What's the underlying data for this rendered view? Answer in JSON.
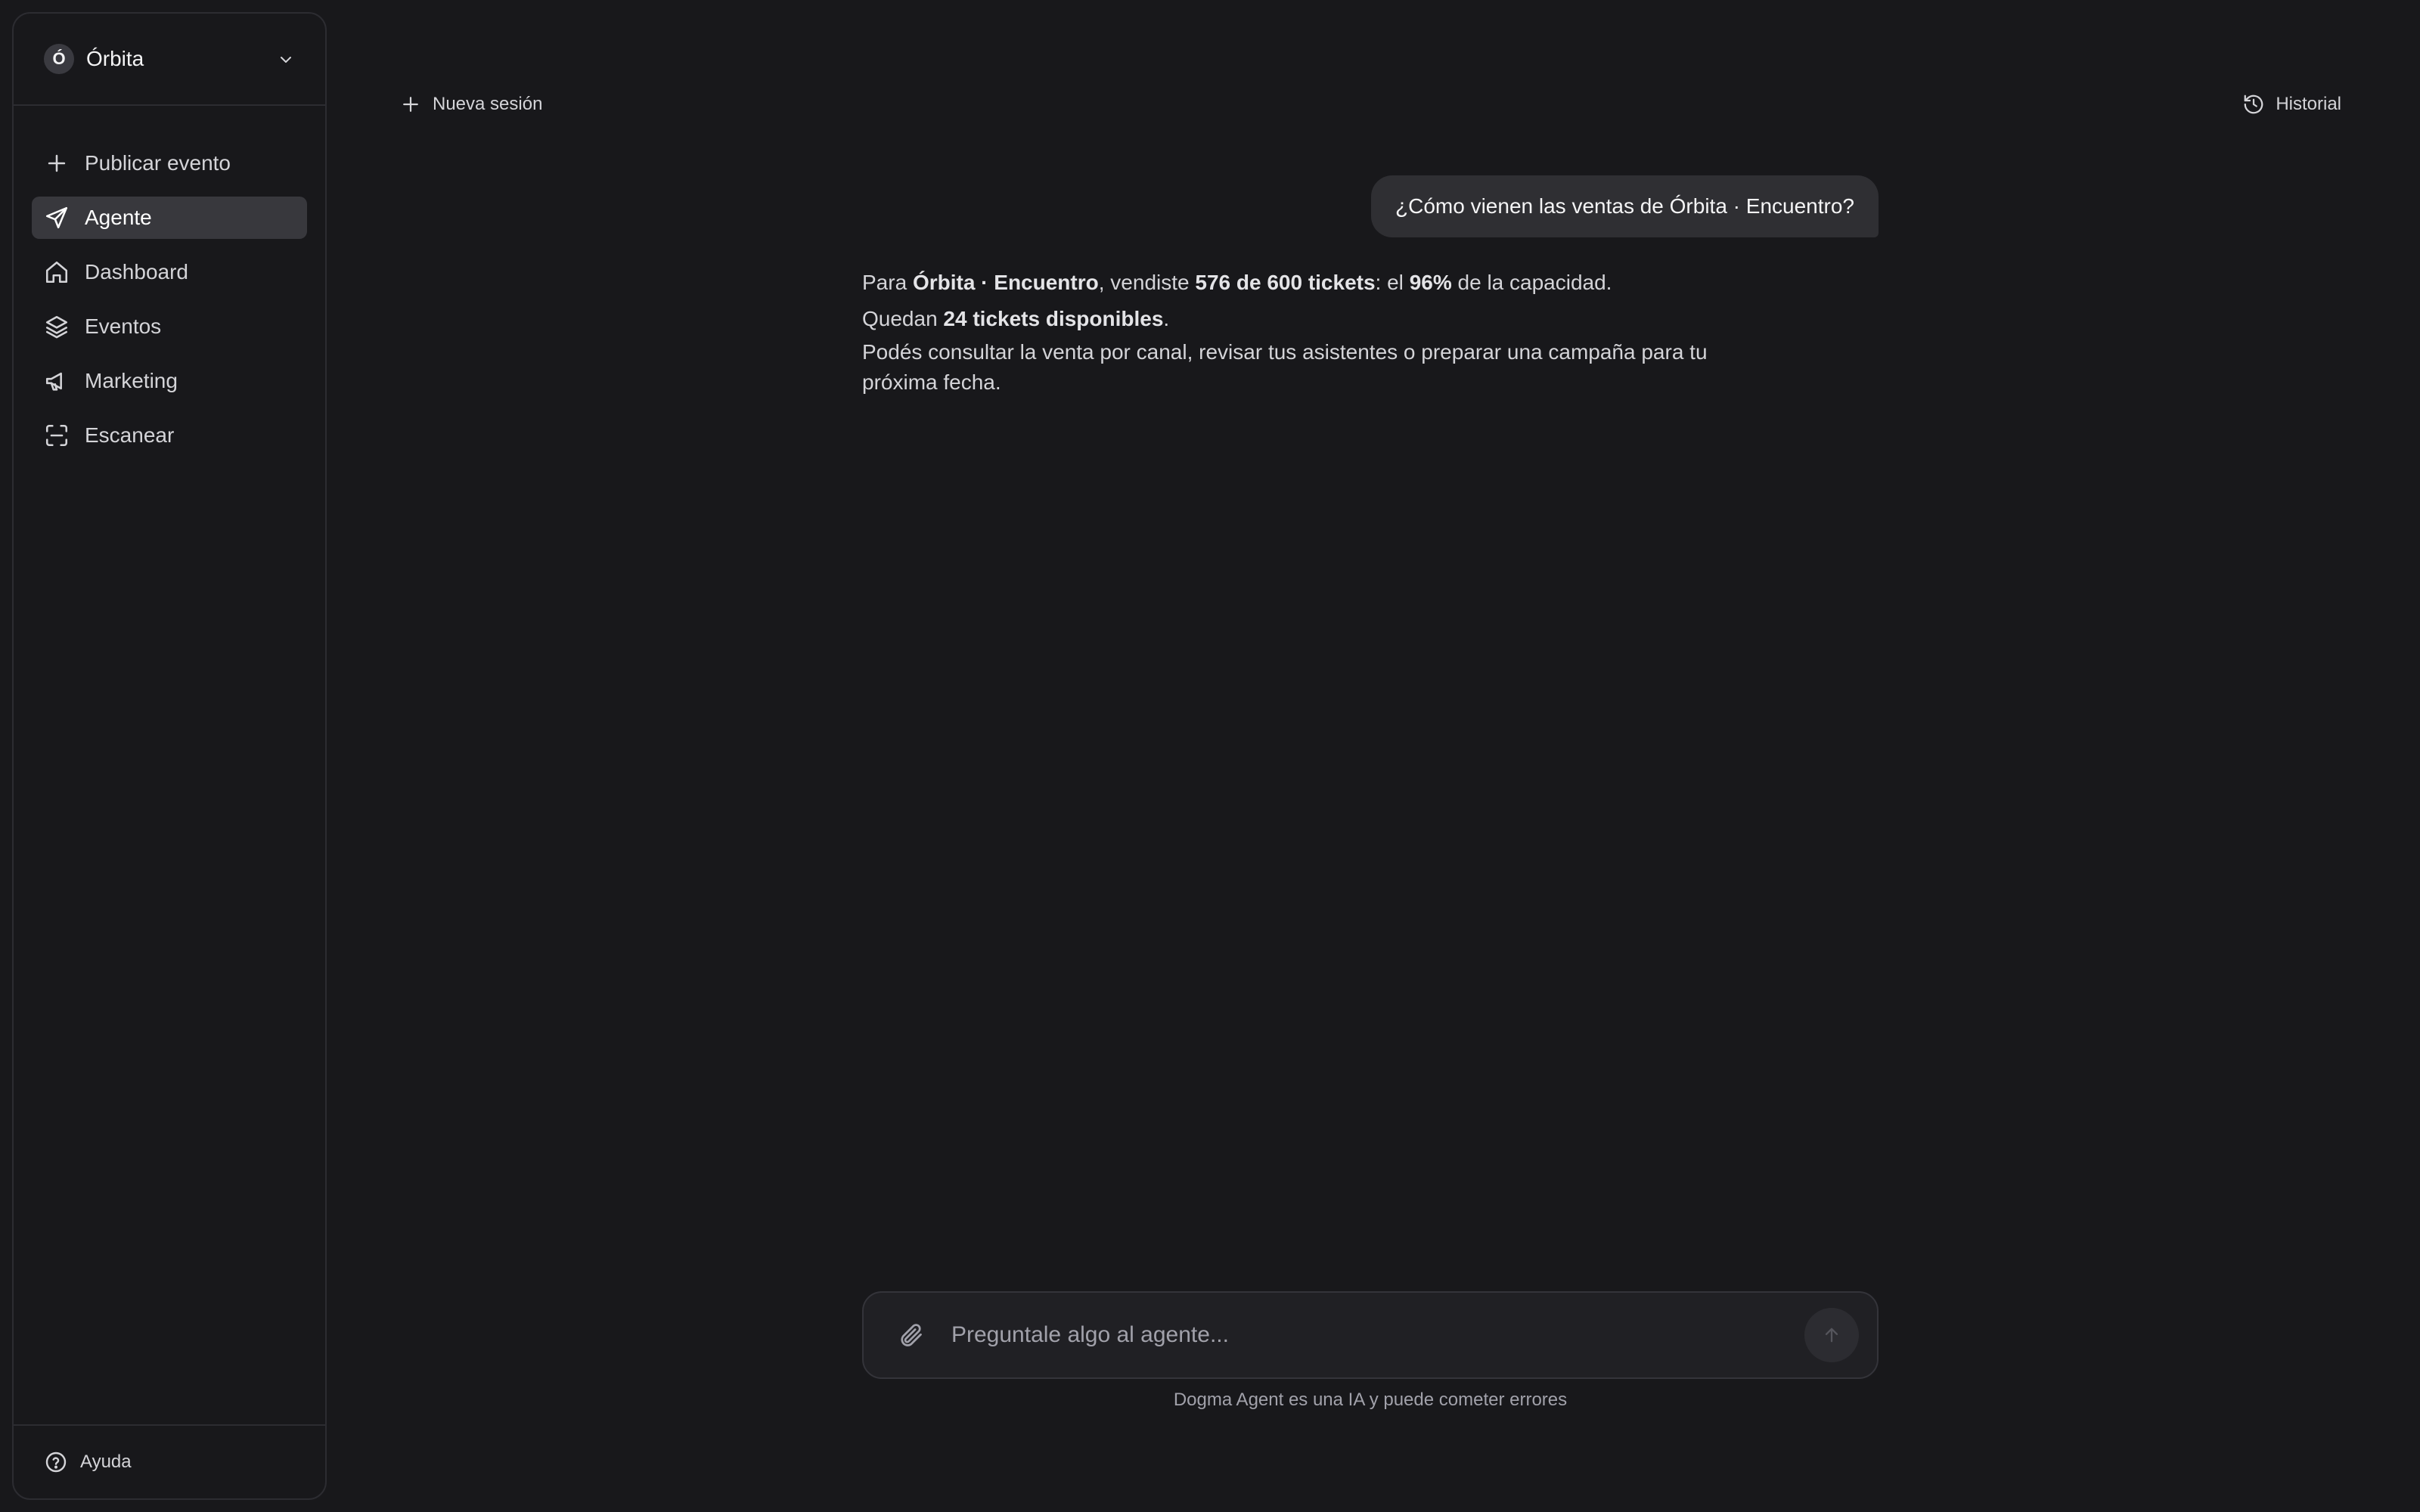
{
  "workspace": {
    "initial": "Ó",
    "name": "Órbita"
  },
  "nav": [
    {
      "label": "Publicar evento",
      "icon": "plus-icon",
      "active": false
    },
    {
      "label": "Agente",
      "icon": "send-icon",
      "active": true
    },
    {
      "label": "Dashboard",
      "icon": "home-icon",
      "active": false
    },
    {
      "label": "Eventos",
      "icon": "layers-icon",
      "active": false
    },
    {
      "label": "Marketing",
      "icon": "megaphone-icon",
      "active": false
    },
    {
      "label": "Escanear",
      "icon": "scan-icon",
      "active": false
    }
  ],
  "footer": {
    "help_label": "Ayuda"
  },
  "topbar": {
    "new_session_label": "Nueva sesión",
    "history_label": "Historial"
  },
  "chat": {
    "user_message": "¿Cómo vienen las ventas de Órbita · Encuentro?",
    "answer": {
      "l1_a": "Para ",
      "l1_event": "Órbita · Encuentro",
      "l1_b": ", vendiste ",
      "l1_sold": "576 de 600 tickets",
      "l1_c": ": el ",
      "l1_pct": "96%",
      "l1_d": " de la capacidad.",
      "l2_a": "Quedan ",
      "l2_avail": "24 tickets disponibles",
      "l2_b": ".",
      "l3": "Podés consultar la venta por canal, revisar tus asistentes o preparar una campaña para tu próxima fecha."
    }
  },
  "composer": {
    "placeholder": "Preguntale algo al agente...",
    "disclaimer": "Dogma Agent es una IA y puede cometer errores"
  }
}
